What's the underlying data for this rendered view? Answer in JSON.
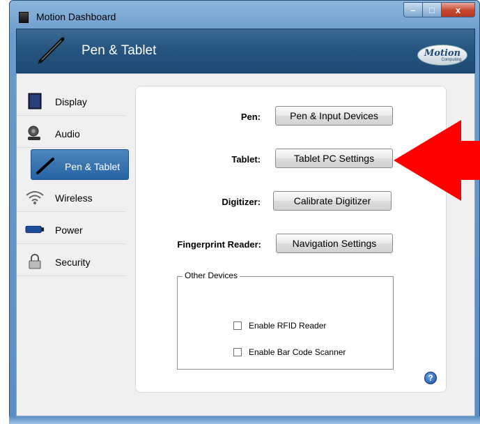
{
  "window": {
    "title": "Motion Dashboard",
    "controls": {
      "minimize": "–",
      "maximize": "□",
      "close": "x"
    }
  },
  "header": {
    "title": "Pen & Tablet",
    "logo_word": "Motion",
    "logo_sub": "Computing"
  },
  "sidebar": {
    "items": [
      {
        "label": "Display",
        "icon": "display-icon"
      },
      {
        "label": "Audio",
        "icon": "audio-icon"
      },
      {
        "label": "Pen & Tablet",
        "icon": "pen-icon",
        "selected": true
      },
      {
        "label": "Wireless",
        "icon": "wireless-icon"
      },
      {
        "label": "Power",
        "icon": "battery-icon"
      },
      {
        "label": "Security",
        "icon": "lock-icon"
      }
    ]
  },
  "main": {
    "rows": [
      {
        "label": "Pen:",
        "button": "Pen & Input Devices"
      },
      {
        "label": "Tablet:",
        "button": "Tablet PC Settings"
      },
      {
        "label": "Digitizer:",
        "button": "Calibrate Digitizer"
      },
      {
        "label": "Fingerprint Reader:",
        "button": "Navigation Settings"
      }
    ],
    "other_devices": {
      "title": "Other Devices",
      "checkboxes": [
        {
          "label": "Enable RFID Reader",
          "checked": false
        },
        {
          "label": "Enable Bar Code Scanner",
          "checked": false
        }
      ]
    },
    "help": "?"
  },
  "colors": {
    "accent": "#2563a3",
    "header": "#24547e",
    "arrow": "#ff0000"
  }
}
